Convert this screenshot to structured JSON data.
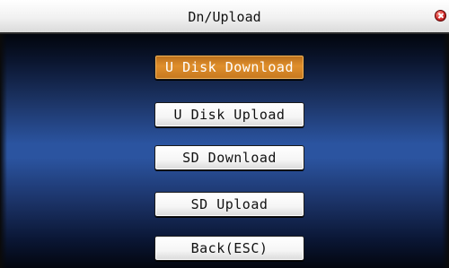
{
  "window": {
    "title": "Dn/Upload",
    "close_icon": "close-icon"
  },
  "menu": {
    "selected_index": 0,
    "items": [
      {
        "label": "U Disk Download"
      },
      {
        "label": "U Disk Upload"
      },
      {
        "label": "SD Download"
      },
      {
        "label": "SD Upload"
      },
      {
        "label": "Back(ESC)"
      }
    ]
  },
  "colors": {
    "selected_bg": "#e08f2c",
    "content_blue": "#2b54a0"
  }
}
